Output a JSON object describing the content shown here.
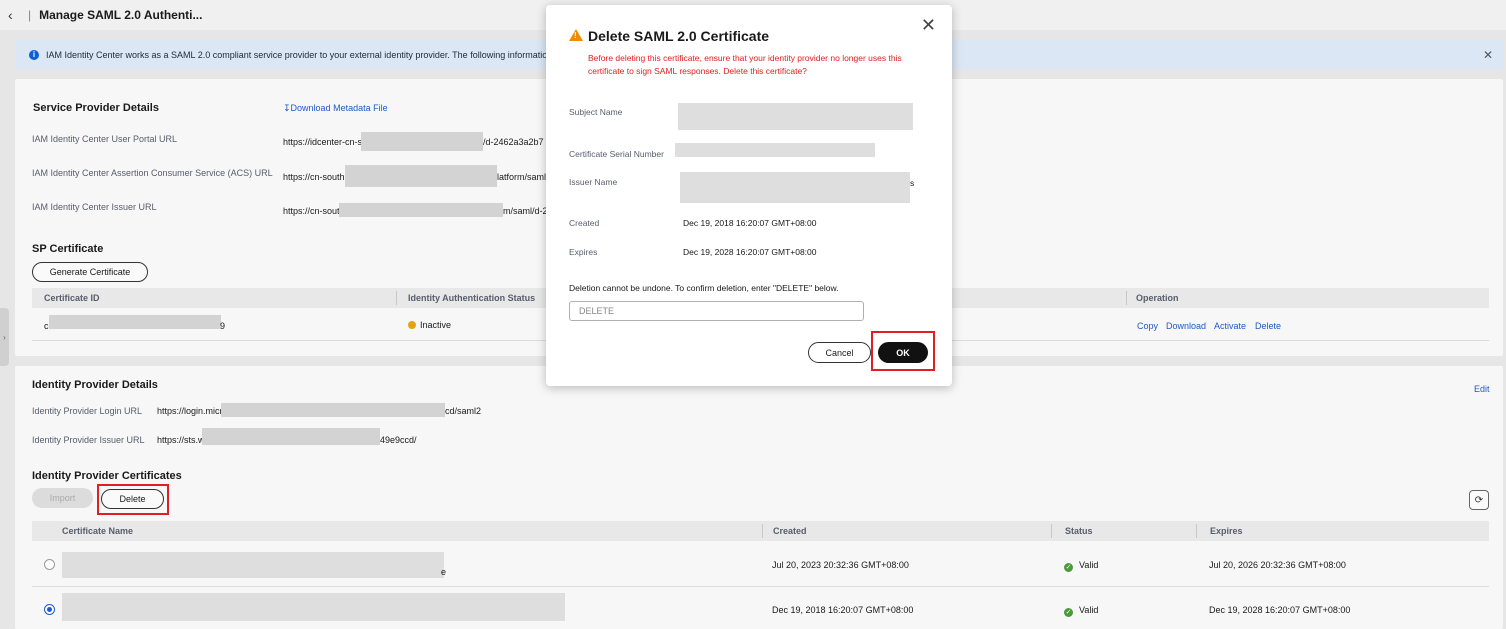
{
  "header": {
    "title": "Manage SAML 2.0 Authenti..."
  },
  "banner": {
    "text": "IAM Identity Center works as a SAML 2.0 compliant service provider to your external identity provider. The following information c"
  },
  "service_provider": {
    "heading": "Service Provider Details",
    "download_link": "Download Metadata File",
    "portal_url_label": "IAM Identity Center User Portal URL",
    "portal_url_prefix": "https://idcenter-cn-s",
    "portal_url_suffix": "/d-2462a3a2b7",
    "acs_url_label": "IAM Identity Center Assertion Consumer Service (ACS) URL",
    "acs_url_prefix": "https://cn-south",
    "acs_url_suffix": "latform/saml/",
    "issuer_url_label": "IAM Identity Center Issuer URL",
    "issuer_url_prefix": "https://cn-sout",
    "issuer_url_suffix": "m/saml/d-2"
  },
  "sp_certificate": {
    "heading": "SP Certificate",
    "generate_button": "Generate Certificate",
    "columns": [
      "Certificate ID",
      "Identity Authentication Status",
      "Operation"
    ],
    "row": {
      "id_prefix": "c",
      "id_suffix": "9",
      "status": "Inactive",
      "actions": [
        "Copy",
        "Download",
        "Activate",
        "Delete"
      ]
    }
  },
  "identity_provider": {
    "heading": "Identity Provider Details",
    "edit_link": "Edit",
    "login_url_label": "Identity Provider Login URL",
    "login_url_prefix": "https://login.micr",
    "login_url_suffix": "cd/saml2",
    "issuer_url_label": "Identity Provider Issuer URL",
    "issuer_url_prefix": "https://sts.w",
    "issuer_url_suffix": "49e9ccd/"
  },
  "idp_certificates": {
    "heading": "Identity Provider Certificates",
    "import_button": "Import",
    "delete_button": "Delete",
    "columns": [
      "Certificate Name",
      "Created",
      "Status",
      "Expires"
    ],
    "rows": [
      {
        "name_suffix": "e",
        "created": "Jul 20, 2023 20:32:36 GMT+08:00",
        "status": "Valid",
        "expires": "Jul 20, 2026 20:32:36 GMT+08:00",
        "selected": false
      },
      {
        "name_suffix": "",
        "created": "Dec 19, 2018 16:20:07 GMT+08:00",
        "status": "Valid",
        "expires": "Dec 19, 2028 16:20:07 GMT+08:00",
        "selected": true
      }
    ]
  },
  "modal": {
    "title": "Delete SAML 2.0 Certificate",
    "warning": "Before deleting this certificate, ensure that your identity provider no longer uses this certificate to sign SAML responses. Delete this certificate?",
    "subject_name_label": "Subject Name",
    "serial_label": "Certificate Serial Number",
    "issuer_label": "Issuer Name",
    "issuer_suffix": "s",
    "created_label": "Created",
    "created_value": "Dec 19, 2018 16:20:07 GMT+08:00",
    "expires_label": "Expires",
    "expires_value": "Dec 19, 2028 16:20:07 GMT+08:00",
    "confirm_prompt": "Deletion cannot be undone. To confirm deletion, enter \"DELETE\" below.",
    "confirm_placeholder": "DELETE",
    "cancel_button": "Cancel",
    "ok_button": "OK"
  },
  "colors": {
    "accent": "#1f58c7",
    "danger": "#e02020",
    "warning": "#e3a50b",
    "success": "#4b9a3b"
  }
}
